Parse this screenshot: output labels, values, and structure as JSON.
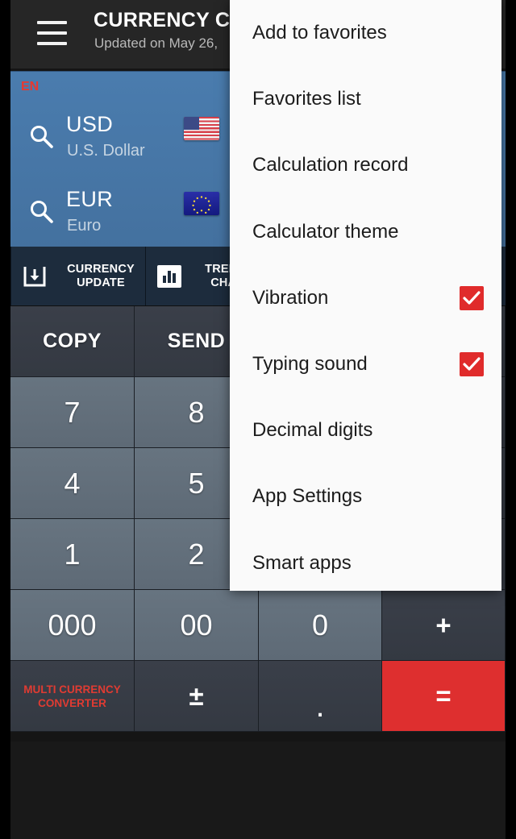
{
  "header": {
    "menu_icon": "hamburger-icon",
    "title": "CURRENCY CO",
    "subtitle": "Updated on May 26,"
  },
  "currency_panel": {
    "language_badge": "EN",
    "rows": [
      {
        "search_icon": "search-icon",
        "code": "USD",
        "name": "U.S. Dollar",
        "flag": "us-flag"
      },
      {
        "search_icon": "search-icon",
        "code": "EUR",
        "name": "Euro",
        "flag": "eu-flag"
      }
    ]
  },
  "action_bar": {
    "buttons": [
      {
        "icon": "download-icon",
        "label": "CURRENCY\nUPDATE"
      },
      {
        "icon": "bar-chart-icon",
        "label": "TRENDS &\nCHARTS"
      }
    ]
  },
  "keypad": {
    "rows": [
      [
        {
          "label": "COPY",
          "style": "dark",
          "kind": "text"
        },
        {
          "label": "SEND",
          "style": "dark",
          "kind": "text"
        },
        {
          "label": "",
          "style": "dark",
          "kind": "text"
        },
        {
          "label": "",
          "style": "dark",
          "kind": "text"
        }
      ],
      [
        {
          "label": "7",
          "style": "light",
          "kind": "num"
        },
        {
          "label": "8",
          "style": "light",
          "kind": "num"
        },
        {
          "label": "",
          "style": "light",
          "kind": "num"
        },
        {
          "label": "",
          "style": "dark",
          "kind": "op"
        }
      ],
      [
        {
          "label": "4",
          "style": "light",
          "kind": "num"
        },
        {
          "label": "5",
          "style": "light",
          "kind": "num"
        },
        {
          "label": "",
          "style": "light",
          "kind": "num"
        },
        {
          "label": "",
          "style": "dark",
          "kind": "op"
        }
      ],
      [
        {
          "label": "1",
          "style": "light",
          "kind": "num"
        },
        {
          "label": "2",
          "style": "light",
          "kind": "num"
        },
        {
          "label": "",
          "style": "light",
          "kind": "num"
        },
        {
          "label": "",
          "style": "dark",
          "kind": "op"
        }
      ],
      [
        {
          "label": "000",
          "style": "light",
          "kind": "num"
        },
        {
          "label": "00",
          "style": "light",
          "kind": "num"
        },
        {
          "label": "0",
          "style": "light",
          "kind": "num"
        },
        {
          "label": "+",
          "style": "dark",
          "kind": "op"
        }
      ],
      [
        {
          "label": "MULTI CURRENCY\nCONVERTER",
          "style": "dark",
          "kind": "brand"
        },
        {
          "label": "±",
          "style": "dark",
          "kind": "op"
        },
        {
          "label": ".",
          "style": "dark",
          "kind": "dot"
        },
        {
          "label": "=",
          "style": "red",
          "kind": "op"
        }
      ]
    ]
  },
  "menu": {
    "items": [
      {
        "label": "Add to favorites",
        "checkbox": null
      },
      {
        "label": "Favorites list",
        "checkbox": null
      },
      {
        "label": "Calculation record",
        "checkbox": null
      },
      {
        "label": "Calculator theme",
        "checkbox": null
      },
      {
        "label": "Vibration",
        "checkbox": true
      },
      {
        "label": "Typing sound",
        "checkbox": true
      },
      {
        "label": "Decimal digits",
        "checkbox": null
      },
      {
        "label": "App Settings",
        "checkbox": null
      },
      {
        "label": "Smart apps",
        "checkbox": null
      }
    ]
  },
  "colors": {
    "accent_red": "#de2f2f",
    "panel_blue": "#4a7cae",
    "header_dark": "#262626",
    "key_light": "#677480",
    "key_dark": "#3a3f49",
    "menu_bg": "#fafafa",
    "checkbox_red": "#e02b2b"
  }
}
